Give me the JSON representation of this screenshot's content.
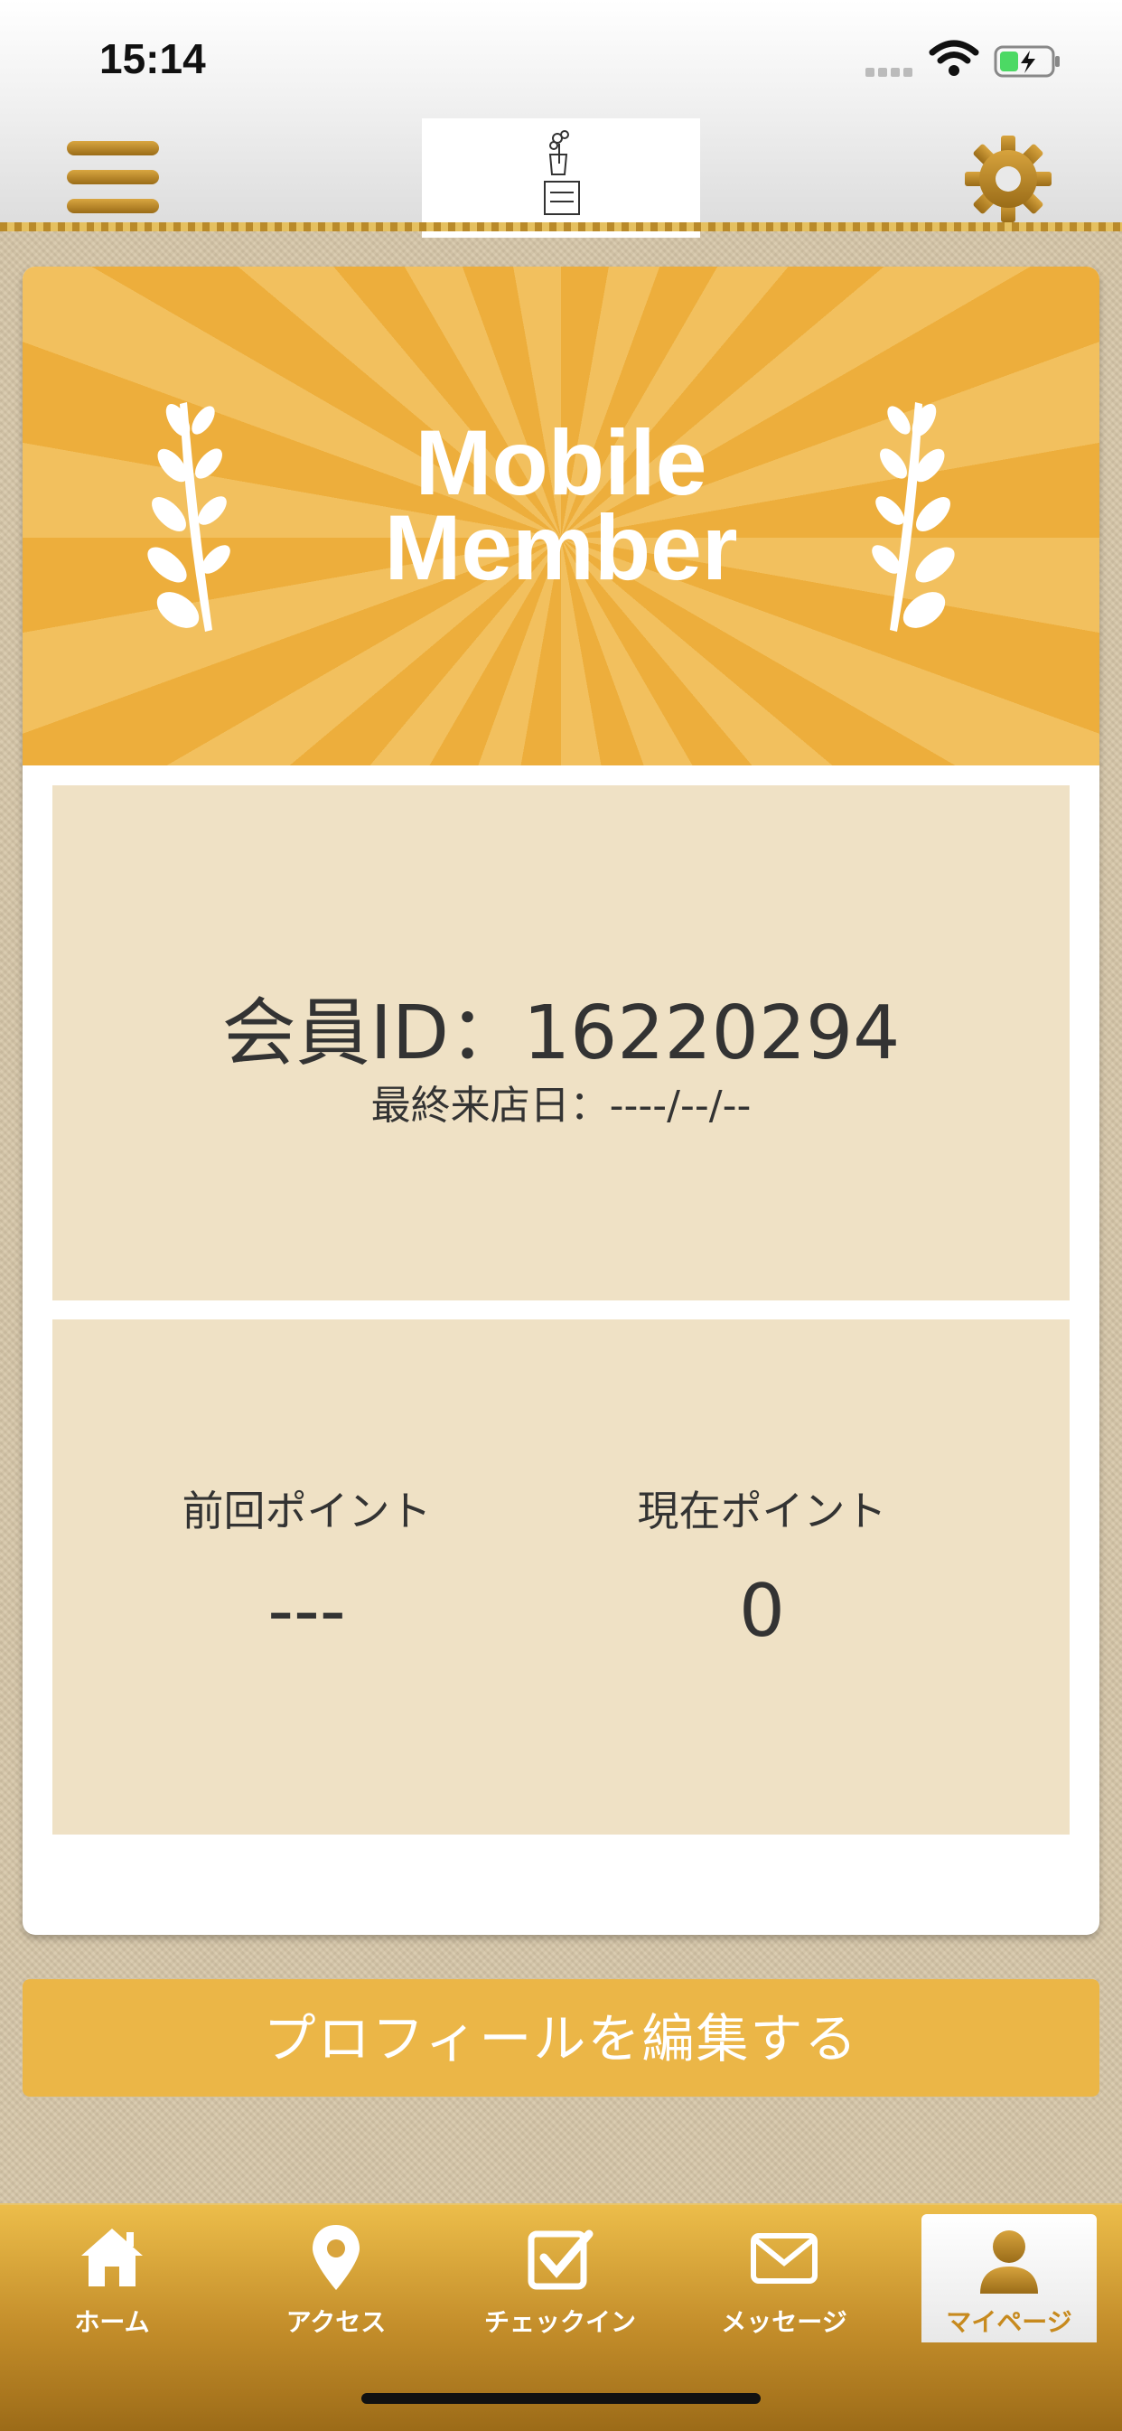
{
  "status_bar": {
    "time": "15:14"
  },
  "header": {
    "logo_alt": "Hair's Daisy"
  },
  "banner": {
    "line1": "Mobile",
    "line2": "Member"
  },
  "member": {
    "id_text": "会員ID：16220294",
    "last_visit_text": "最終来店日：----/--/--"
  },
  "points": {
    "previous_label": "前回ポイント",
    "previous_value": "---",
    "current_label": "現在ポイント",
    "current_value": "0"
  },
  "edit_button_label": "プロフィールを編集する",
  "tabs": [
    {
      "label": "ホーム",
      "icon": "home-icon"
    },
    {
      "label": "アクセス",
      "icon": "map-pin-icon"
    },
    {
      "label": "チェックイン",
      "icon": "checkbox-icon"
    },
    {
      "label": "メッセージ",
      "icon": "mail-icon"
    },
    {
      "label": "マイページ",
      "icon": "person-icon",
      "active": true
    }
  ],
  "colors": {
    "accent": "#ebb647",
    "panel": "#efe1c5",
    "active_tab_text": "#c78a1e"
  }
}
